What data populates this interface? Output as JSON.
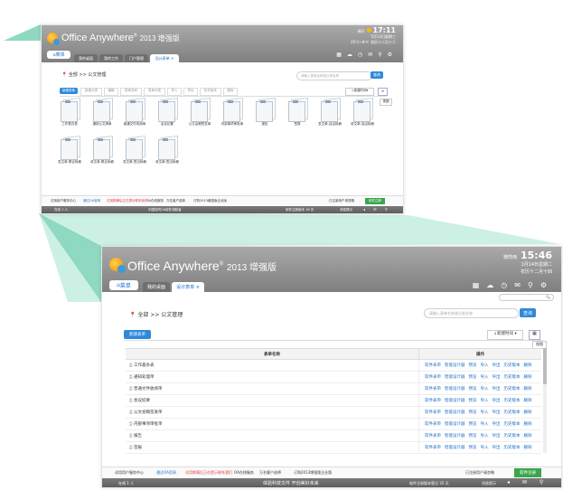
{
  "colors": {
    "accent_green": "#8fd8c2",
    "title_gray": "#8c8c8c",
    "tab_blue": "#1a6fc9",
    "button_blue": "#2f88da",
    "link_red": "#e33b3b",
    "footer_green": "#3aa64b"
  },
  "app": {
    "brand": "Office Anywhere",
    "sup": "®",
    "edition": "2013 增强版",
    "menu_label": "菜单"
  },
  "small": {
    "weather": "晴天",
    "time": "17:11",
    "date": "5月13日星期三",
    "temp": "25℃~8℃",
    "lunar": "农历十二月十二",
    "tabs": [
      "我的桌面",
      "我的工作",
      "门户管理",
      "设计表单"
    ],
    "breadcrumb_root": "全部",
    "breadcrumb_current": ">> 公文管理",
    "search_placeholder": "请输入表单名称或分类名称",
    "search_btn": "查询",
    "toolbar": [
      "新建表单",
      "新建分类",
      "编辑",
      "表单名称",
      "表单分类",
      "导入",
      "导出",
      "历史版本",
      "删除"
    ],
    "create_btn": "新建时间",
    "tooltip": "视图",
    "docs": [
      "工作督办表",
      "通用公文清单",
      "普通文件收阅单",
      "会议纪要",
      "公文会稿签发单",
      "内部事项审批单",
      "报告",
      "签报",
      "发文单-自由拟稿",
      "收文单-自由拟稿",
      "发文单-联合拟稿",
      "收文单-联合拟稿",
      "发文单-签出拟稿",
      "收文单-签出拟稿"
    ],
    "footer_links": [
      "试用用户服务中心",
      "通达OA官网",
      "试用期满后正在提示联系我们",
      "OA在线服务",
      "万名客户选择",
      "订购2013增强版企业版"
    ],
    "footer_right": "已注册用户请忽略",
    "footer_btn": "软件注册",
    "status_left": "在线 1 人",
    "status_center": "中国协同OA软件领航者",
    "status_right": "软件注册版本 16 天",
    "status_msg": "消息提示"
  },
  "large": {
    "weather": "微阵雨",
    "time": "15:46",
    "date": "1月14日星期二",
    "lunar": "农历十二月十四",
    "tabs": [
      "我的桌面",
      "设计表单"
    ],
    "breadcrumb_root": "全部",
    "breadcrumb_current": ">> 公文管理",
    "search_placeholder": "请输入表单名称或分类名称",
    "search_btn": "查询",
    "new_btn": "新建表单",
    "create_btn": "新建时间",
    "tooltip": "视图",
    "table": {
      "headers": [
        "表单名称",
        "操作"
      ],
      "rows": [
        "工作督办表",
        "通知处理单",
        "普通文件收阅单",
        "会议纪要",
        "公文会稿签发单",
        "内部事项审批单",
        "报告",
        "签报"
      ],
      "actions": [
        "软件表单",
        "智能设计器",
        "预览",
        "导入",
        "导出",
        "历史版本",
        "删除"
      ]
    },
    "footer_links": [
      "试用用户服务中心",
      "通达OA官网",
      "试用期满后正在提示联系我们",
      "OA在线服务",
      "万名客户选择",
      "订购2013增强版企业版"
    ],
    "footer_right": "已注册用户请忽略",
    "footer_btn": "软件注册",
    "status_left": "在线 1 人",
    "status_center": "体验科技文件 开创美好未来",
    "status_right": "软件注册版本登记 35 天",
    "status_msg": "消息提示"
  }
}
